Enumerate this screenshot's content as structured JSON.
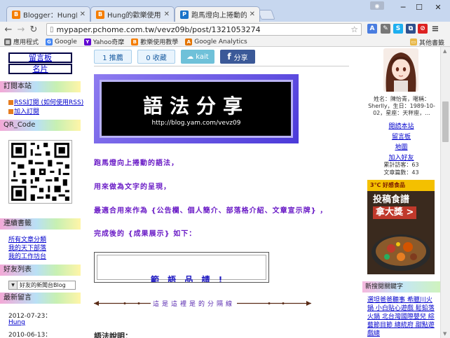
{
  "browser": {
    "tabs": [
      {
        "label": "Blogger：Hung的歡樂",
        "favicon": "B",
        "color": "#f57d00"
      },
      {
        "label": "Hung的歡樂使用教學",
        "favicon": "B",
        "color": "#f57d00"
      },
      {
        "label": "跑馬燈向上捲動的語法 - P",
        "favicon": "P",
        "color": "#1a73c9"
      }
    ],
    "url": "mypaper.pchome.com.tw/vevz09b/post/1321053274",
    "bookmarks": [
      {
        "label": "應用程式",
        "icon": "grid-icon",
        "color": "#666"
      },
      {
        "label": "Google",
        "icon": "G",
        "color": "#4285f4"
      },
      {
        "label": "Yahoo奇摩",
        "icon": "Y",
        "color": "#6001d2"
      },
      {
        "label": "歡樂使用教學",
        "icon": "B",
        "color": "#f57d00"
      },
      {
        "label": "Google Analytics",
        "icon": "A",
        "color": "#e37400"
      }
    ],
    "other_bookmarks": "其他書籤"
  },
  "left": {
    "nav_buttons": [
      "留言板",
      "名片"
    ],
    "subscribe_head": "訂閱本站",
    "subscribe_links": [
      "RSS訂閱 (如何使用RSS)",
      "加入訂閱"
    ],
    "qr_head": "QR_Code",
    "series_head": "連續書籤",
    "series_links": [
      "所有文章分類",
      "我的天下部落",
      "我的工作坊台"
    ],
    "friends_head": "好友列表",
    "friends_select": "好友的新聞台Blog",
    "latest_head": "最新留言",
    "latest_dates": [
      "2012-07-23：",
      "Hung",
      "2010-06-13："
    ]
  },
  "center": {
    "share": [
      {
        "label": "1  推薦",
        "kind": "recommend"
      },
      {
        "label": "0  收藏",
        "kind": "collect"
      },
      {
        "label": "kait",
        "kind": "plurk"
      },
      {
        "label": "分享",
        "kind": "facebook"
      }
    ],
    "banner_title": "語法分享",
    "banner_url": "http://blog.yam.com/vevz09",
    "paragraphs": [
      "跑馬燈向上捲動的語法，",
      "用來做為文字的呈現，",
      "最適合用來作為 {公告欄、個人簡介、部落格介紹、文章宣示牌} ，",
      "完成後的 {成果展示} 如下："
    ],
    "marquee_text": "範 語 品 請 !",
    "divider_text": "這是這裡是的分隔線",
    "syntax_label": "語法說明："
  },
  "right": {
    "profile": "姓名：陳怡青，暱稱：Sherlly，生日：1989-10-02，星座：天秤座，...",
    "links": [
      "閱読本站",
      "留言板",
      "地圖",
      "加入好友"
    ],
    "stats": [
      "累計訪客：63",
      "文章篇數：43"
    ],
    "ad_top": "3℃ 好感食品",
    "ad_lines": [
      "投稿食譜",
      "拿大獎 >"
    ],
    "news_head": "新搜閱關鍵字",
    "news_text": "選坦爸爸聽事 希臘川火鍋 小白貼心遊戲 鬆鉛落火鍋 北台灣國際嬰兒 綜藝節目節 總統府 甜點遊戲總"
  }
}
